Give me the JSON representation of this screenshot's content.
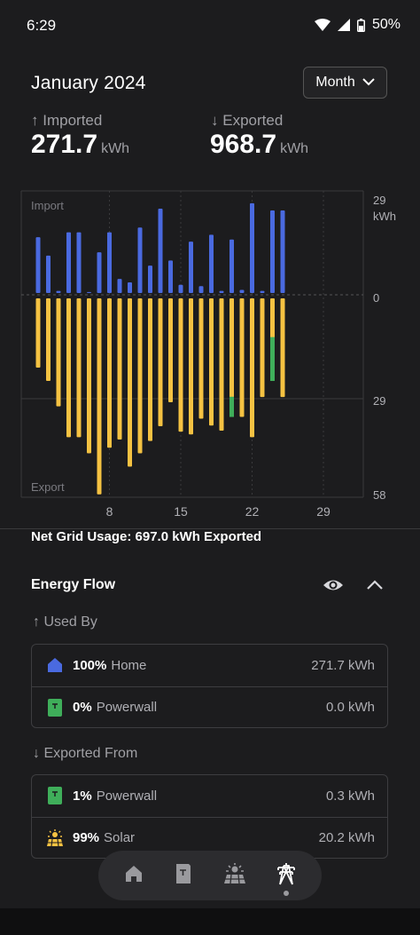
{
  "status": {
    "time": "6:29",
    "battery": "50%"
  },
  "header": {
    "title": "January 2024",
    "period": "Month"
  },
  "stats": {
    "imported_label": "Imported",
    "imported_value": "271.7",
    "exported_label": "Exported",
    "exported_value": "968.7",
    "unit": "kWh"
  },
  "chart_data": {
    "type": "bar",
    "title": "",
    "import_label": "Import",
    "export_label": "Export",
    "y_unit": "kWh",
    "right_ticks": [
      "29",
      "0",
      "29",
      "58"
    ],
    "x_ticks": [
      "8",
      "15",
      "22",
      "29"
    ],
    "days": [
      1,
      2,
      3,
      4,
      5,
      6,
      7,
      8,
      9,
      10,
      11,
      12,
      13,
      14,
      15,
      16,
      17,
      18,
      19,
      20,
      21,
      22,
      23,
      24,
      25
    ],
    "import": [
      16.3,
      10.9,
      0.6,
      17.7,
      17.7,
      0.3,
      11.9,
      17.7,
      4.1,
      3.1,
      19.1,
      8.0,
      24.6,
      9.5,
      2.4,
      15.0,
      2.0,
      17.0,
      0.6,
      15.6,
      0.9,
      26.2,
      0.6,
      24.1,
      24.1
    ],
    "export_grid": [
      20.2,
      24.1,
      31.5,
      40.5,
      40.5,
      45.2,
      57.2,
      43.6,
      41.2,
      49.1,
      45.2,
      41.6,
      37.3,
      30.3,
      38.9,
      39.7,
      35.1,
      37.1,
      38.6,
      34.6,
      34.6,
      40.5,
      28.8,
      24.1,
      28.8
    ],
    "export_powerwall": [
      0,
      0,
      0,
      0,
      0,
      0,
      0,
      0,
      0,
      0,
      0,
      0,
      0,
      0,
      0,
      0,
      0,
      0,
      0,
      5.9,
      0,
      0,
      0,
      12.8,
      0
    ],
    "colors": {
      "import": "#4a6ae0",
      "export": "#f5c242",
      "powerwall": "#3fae5a"
    }
  },
  "net_usage": "Net Grid Usage: 697.0 kWh Exported",
  "energy_flow": {
    "title": "Energy Flow",
    "used_by_label": "Used By",
    "used_by": [
      {
        "pct": "100%",
        "name": "Home",
        "value": "271.7 kWh",
        "icon": "home-icon"
      },
      {
        "pct": "0%",
        "name": "Powerwall",
        "value": "0.0 kWh",
        "icon": "powerwall-icon"
      }
    ],
    "exported_from_label": "Exported From",
    "exported_from": [
      {
        "pct": "1%",
        "name": "Powerwall",
        "value": "0.3 kWh",
        "icon": "powerwall-icon"
      },
      {
        "pct": "99%",
        "name": "Solar",
        "value": "20.2 kWh",
        "icon": "solar-icon"
      }
    ]
  },
  "nav": [
    "home-icon",
    "powerwall-icon",
    "solar-icon",
    "grid-icon"
  ]
}
